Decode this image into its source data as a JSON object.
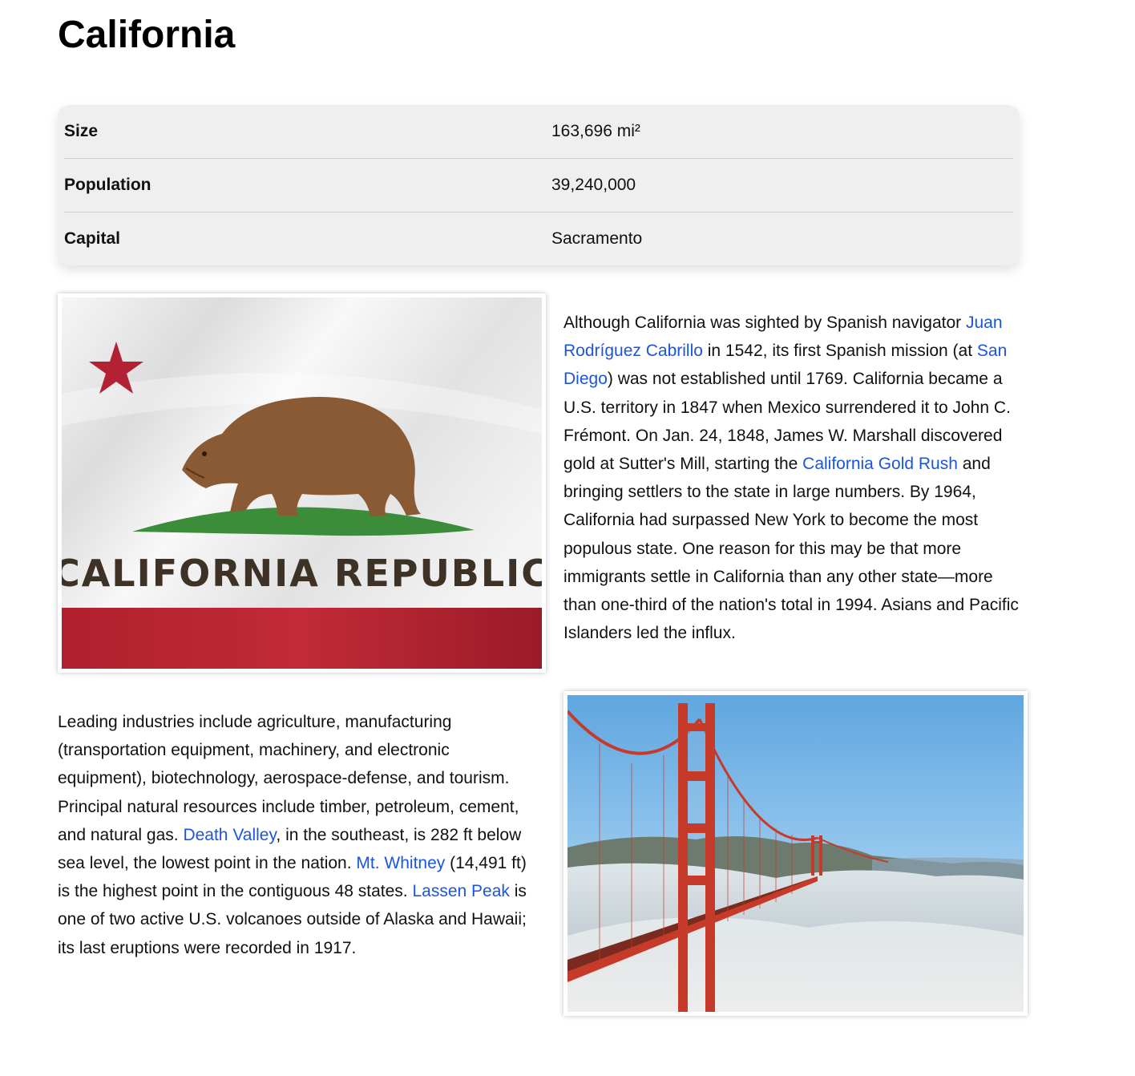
{
  "title": "California",
  "facts": [
    {
      "label": "Size",
      "value": "163,696 mi²"
    },
    {
      "label": "Population",
      "value": "39,240,000"
    },
    {
      "label": "Capital",
      "value": "Sacramento"
    }
  ],
  "flag_image": {
    "icon": "california-flag-image",
    "text": "CALIFORNIA REPUBLIC",
    "colors": {
      "star": "#b22234",
      "bear": "#8a5a34",
      "grass": "#3c8d3a",
      "stripe": "#b0202e"
    }
  },
  "bridge_image": {
    "icon": "golden-gate-bridge-photo",
    "colors": {
      "bridge": "#c63a2a",
      "sky": "#7fb9e8",
      "fog": "#e6ecef"
    }
  },
  "history": {
    "t1": "Although California was sighted by Spanish navigator ",
    "link1": "Juan Rodríguez Cabrillo",
    "t2": " in 1542, its first Spanish mission (at ",
    "link2": "San Diego",
    "t3": ") was not established until 1769. California became a U.S. territory in 1847 when Mexico surrendered it to John C. Frémont. On Jan. 24, 1848, James W. Marshall discovered gold at Sutter's Mill, starting the ",
    "link3": "California Gold Rush",
    "t4": " and bringing settlers to the state in large numbers. By 1964, California had surpassed New York to become the most populous state. One reason for this may be that more immigrants settle in California than any other state—more than one-third of the nation's total in 1994. Asians and Pacific Islanders led the influx."
  },
  "industry": {
    "t1": "Leading industries include agriculture, manufacturing (transportation equipment, machinery, and electronic equipment), biotechnology, aerospace-defense, and tourism. Principal natural resources include timber, petroleum, cement, and natural gas. ",
    "link1": "Death Valley",
    "t2": ", in the southeast, is 282 ft below sea level, the lowest point in the nation. ",
    "link2": "Mt. Whitney",
    "t3": " (14,491 ft) is the highest point in the contiguous 48 states. ",
    "link3": "Lassen Peak",
    "t4": " is one of two active U.S. volcanoes outside of Alaska and Hawaii; its last eruptions were recorded in 1917."
  }
}
